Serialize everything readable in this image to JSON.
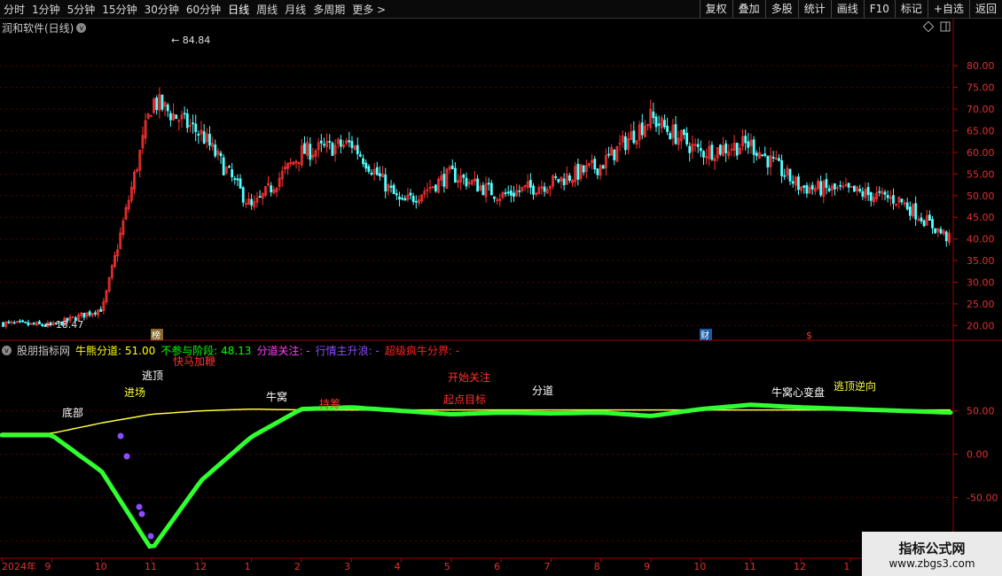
{
  "toolbar": {
    "timeframes": [
      "分时",
      "1分钟",
      "5分钟",
      "15分钟",
      "30分钟",
      "60分钟",
      "日线",
      "周线",
      "月线",
      "多周期",
      "更多 >"
    ],
    "active": "日线",
    "actions": [
      "复权",
      "叠加",
      "多股",
      "统计",
      "画线",
      "F10",
      "标记",
      "+自选",
      "返回"
    ]
  },
  "main_chart": {
    "title": "润和软件(日线)",
    "high_label": "84.84",
    "low_label": "18.47",
    "y_ticks": [
      "80.00",
      "75.00",
      "70.00",
      "65.00",
      "60.00",
      "55.00",
      "50.00",
      "45.00",
      "40.00",
      "35.00",
      "30.00",
      "25.00",
      "20.00"
    ],
    "badges": [
      "榜",
      "财",
      "$"
    ]
  },
  "indicator": {
    "name": "股朋指标网",
    "items": [
      {
        "label": "牛熊分道:",
        "value": "51.00",
        "color": "#ffff00"
      },
      {
        "label": "不参与阶段:",
        "value": "48.13",
        "color": "#00ff00"
      },
      {
        "label": "分道关注:",
        "value": "-",
        "color": "#ff3cff"
      },
      {
        "label": "行情主升浪:",
        "value": "-",
        "color": "#8a4cff"
      },
      {
        "label": "超级疯牛分界:",
        "value": "-",
        "color": "#ff2020"
      }
    ],
    "y_ticks": [
      "50.00",
      "0.00",
      "-50.00",
      "-100.0"
    ],
    "annotations": [
      "逃顶",
      "快马加鞭",
      "开始关注",
      "牛窝",
      "牛窝心变盘",
      "起点目标",
      "进场",
      "底部",
      "持筹",
      "逃顶逆向",
      "分道"
    ]
  },
  "x_axis": {
    "labels": [
      "2024年",
      "9",
      "10",
      "11",
      "12",
      "1",
      "2",
      "3",
      "4",
      "5",
      "6",
      "7",
      "8",
      "9",
      "10",
      "11",
      "12",
      "1",
      "2",
      "3"
    ]
  },
  "watermark": {
    "title": "指标公式网",
    "url": "www.zbgs3.com"
  },
  "chart_data": {
    "type": "line",
    "title": "润和软件(日线)",
    "x": [
      "2024-08",
      "2024-09",
      "2024-10",
      "2024-11",
      "2024-12",
      "2025-01",
      "2025-02",
      "2025-03",
      "2025-04",
      "2025-05",
      "2025-06",
      "2025-07",
      "2025-08",
      "2025-09",
      "2025-10",
      "2025-11",
      "2025-12",
      "2026-01",
      "2026-02",
      "2026-03"
    ],
    "series": [
      {
        "name": "close",
        "values": [
          20.5,
          20,
          24,
          72,
          64,
          47,
          60,
          62,
          48,
          55,
          50,
          53,
          57,
          68,
          60,
          62,
          52,
          51,
          49,
          40
        ]
      }
    ],
    "ylim": [
      17,
      87
    ],
    "indicator": {
      "series": [
        {
          "name": "牛熊分道",
          "values": [
            24,
            24,
            36,
            46,
            50,
            52,
            51,
            51,
            51,
            51,
            51,
            51,
            51,
            51,
            51,
            51,
            51,
            51,
            51,
            51
          ]
        },
        {
          "name": "不参与阶段",
          "values": [
            22,
            22,
            -20,
            -110,
            -30,
            20,
            52,
            54,
            50,
            46,
            48,
            47,
            48,
            44,
            52,
            57,
            54,
            52,
            50,
            48
          ]
        }
      ],
      "ylim": [
        -115,
        115
      ]
    }
  }
}
